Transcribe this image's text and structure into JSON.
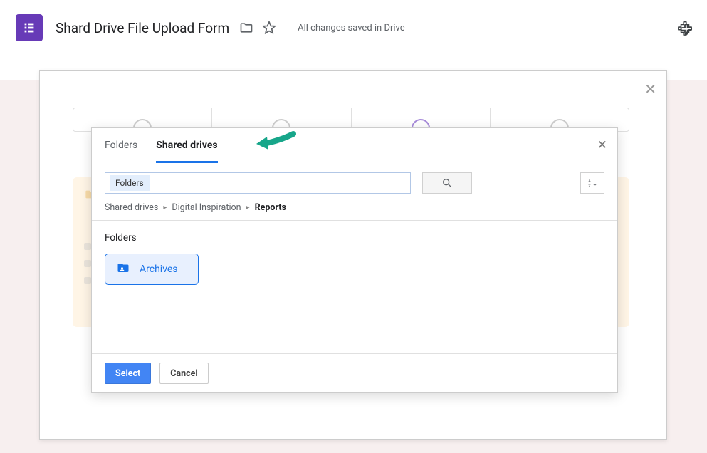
{
  "header": {
    "title": "Shard Drive File Upload Form",
    "save_status": "All changes saved in Drive"
  },
  "picker": {
    "tabs": {
      "folders": "Folders",
      "shared_drives": "Shared drives"
    },
    "search_chip": "Folders",
    "breadcrumb": {
      "root": "Shared drives",
      "mid": "Digital Inspiration",
      "current": "Reports"
    },
    "section_label": "Folders",
    "folder_item": "Archives",
    "buttons": {
      "select": "Select",
      "cancel": "Cancel"
    }
  }
}
